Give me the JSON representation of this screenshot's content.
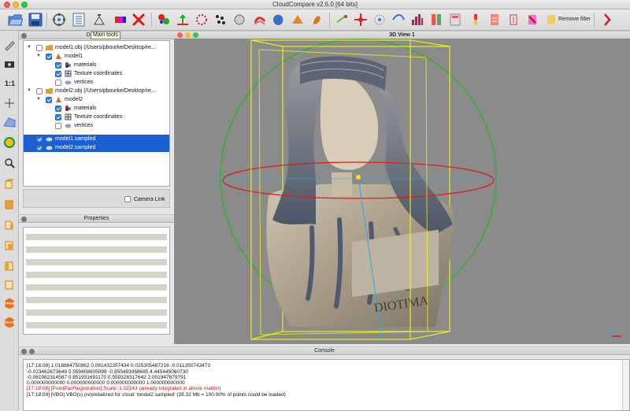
{
  "window": {
    "title": "CloudCompare v2.6.0 [64 bits]"
  },
  "toolbar": {
    "tooltip": "Main tools",
    "remove_filter_label": "Remove filter",
    "icons": [
      "open-icon",
      "save-icon",
      "translate-rotate-icon",
      "list-icon",
      "main-tools-icon",
      "color-scale-icon",
      "delete-icon"
    ]
  },
  "db_tree": {
    "title": "DB Tree",
    "rows": [
      {
        "label": "model1.obj (/Users/pbourke/Desktop/re...",
        "checked": false
      },
      {
        "label": "model1",
        "checked": true
      },
      {
        "label": "materials",
        "checked": true
      },
      {
        "label": "Texture coordinates",
        "checked": true
      },
      {
        "label": "vertices",
        "checked": false
      },
      {
        "label": "model2.obj (/Users/pbourke/Desktop/re...",
        "checked": false
      },
      {
        "label": "model2",
        "checked": true
      },
      {
        "label": "materials",
        "checked": true
      },
      {
        "label": "Texture coordinates",
        "checked": true
      },
      {
        "label": "vertices",
        "checked": false
      },
      {
        "label": "model1.sampled",
        "checked": true,
        "selected": true
      },
      {
        "label": "model2.sampled",
        "checked": true,
        "selected": true
      }
    ],
    "camera_link_label": "Camera Link"
  },
  "properties": {
    "title": "Properties"
  },
  "view3d": {
    "title": "3D View 1",
    "statue_text": "DIOTIMA"
  },
  "console": {
    "title": "Console",
    "lines": [
      {
        "text": "[17:18:08] 1.018864750862 0.081432357434 0.025305487216 -0.011350743473",
        "red": false
      },
      {
        "text": "-0.023462673649 0.559408605099 -0.855493068695 4.445445060730",
        "red": false
      },
      {
        "text": "-0.081982314587 0.851931691170 0.559328317642 2.001947879791",
        "red": false
      },
      {
        "text": "0.000000000000 0.000000000000 0.000000000000 1.000000000000",
        "red": false
      },
      {
        "text": "[17:18:08] [PointPairRegistration] Scale: 1.02243 (already integrated in above matrix!)",
        "red": true
      },
      {
        "text": "[17:18:09] [VBO] VBO(s) (re)initialized for cloud 'model2.sampled' (28.32 Mb = 100.00% of points could be loaded)",
        "red": false
      }
    ]
  },
  "colors": {
    "selection": "#1b5fd4",
    "bbox": "#ffff00",
    "console_warning": "#c0141e"
  }
}
